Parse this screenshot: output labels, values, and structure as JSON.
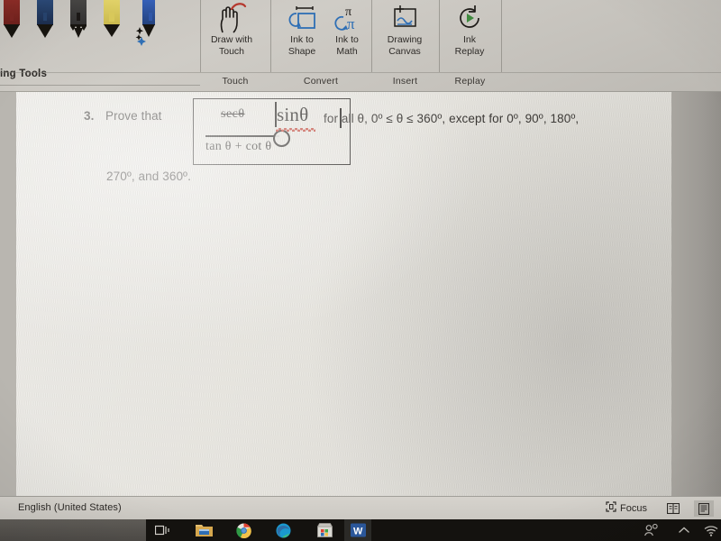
{
  "ribbon": {
    "contextual_tab_label": "ing Tools",
    "pens": [
      {
        "name": "pen-dark-red",
        "barrel": "#7d2622",
        "tip": "#1b1816"
      },
      {
        "name": "pen-blue-galaxy",
        "barrel": "#27436e",
        "tip": "#141b26"
      },
      {
        "name": "pencil-black",
        "barrel": "#3d3c3a",
        "tip": "#1b1816"
      },
      {
        "name": "highlighter-yellow",
        "barrel": "#d8c85a",
        "tip": "#16130f"
      },
      {
        "name": "action-pen-blue",
        "barrel": "#2f56a8",
        "tip": "#16130f"
      }
    ],
    "buttons": [
      {
        "label_line1": "Draw with",
        "label_line2": "Touch",
        "icon": "hand-draw-icon",
        "name": "draw-with-touch-button"
      },
      {
        "label_line1": "Ink to",
        "label_line2": "Shape",
        "icon": "ink-to-shape-icon",
        "name": "ink-to-shape-button"
      },
      {
        "label_line1": "Ink to",
        "label_line2": "Math",
        "icon": "ink-to-math-icon",
        "name": "ink-to-math-button"
      },
      {
        "label_line1": "Drawing",
        "label_line2": "Canvas",
        "icon": "drawing-canvas-icon",
        "name": "drawing-canvas-button"
      },
      {
        "label_line1": "Ink",
        "label_line2": "Replay",
        "icon": "ink-replay-icon",
        "name": "ink-replay-button"
      }
    ],
    "groups": [
      {
        "label": "Touch"
      },
      {
        "label": "Convert"
      },
      {
        "label": "Insert"
      },
      {
        "label": "Replay"
      }
    ]
  },
  "document": {
    "problem_number": "3.",
    "lead_text": "Prove that",
    "equation": {
      "numerator": "secθ",
      "numerator_struck": true,
      "denominator": "tan θ + cot θ",
      "inserted_term": "sinθ",
      "spellcheck_underline": true,
      "has_selection_handle": true
    },
    "tail_text": "for all θ, 0º ≤ θ ≤ 360º, except for 0º, 90º, 180º,",
    "line2_text": "270º, and 360º."
  },
  "statusbar": {
    "language": "English (United States)",
    "focus_label": "Focus",
    "views": [
      {
        "name": "read-mode-icon",
        "active": false
      },
      {
        "name": "print-layout-icon",
        "active": true
      }
    ]
  },
  "taskbar": {
    "items": [
      {
        "name": "task-view-icon"
      },
      {
        "name": "file-explorer-icon"
      },
      {
        "name": "chrome-icon"
      },
      {
        "name": "edge-icon"
      },
      {
        "name": "microsoft-store-icon"
      },
      {
        "name": "word-icon",
        "active": true
      }
    ],
    "tray": [
      {
        "name": "people-icon"
      },
      {
        "name": "show-hidden-icons-chevron-icon"
      },
      {
        "name": "wifi-icon"
      }
    ]
  },
  "colors": {
    "page": "#e8e6e0",
    "ribbon": "#c9c6c0",
    "accent_blue": "#2f6fb5",
    "spell_red": "#c0392b",
    "taskbar": "#14120f"
  }
}
